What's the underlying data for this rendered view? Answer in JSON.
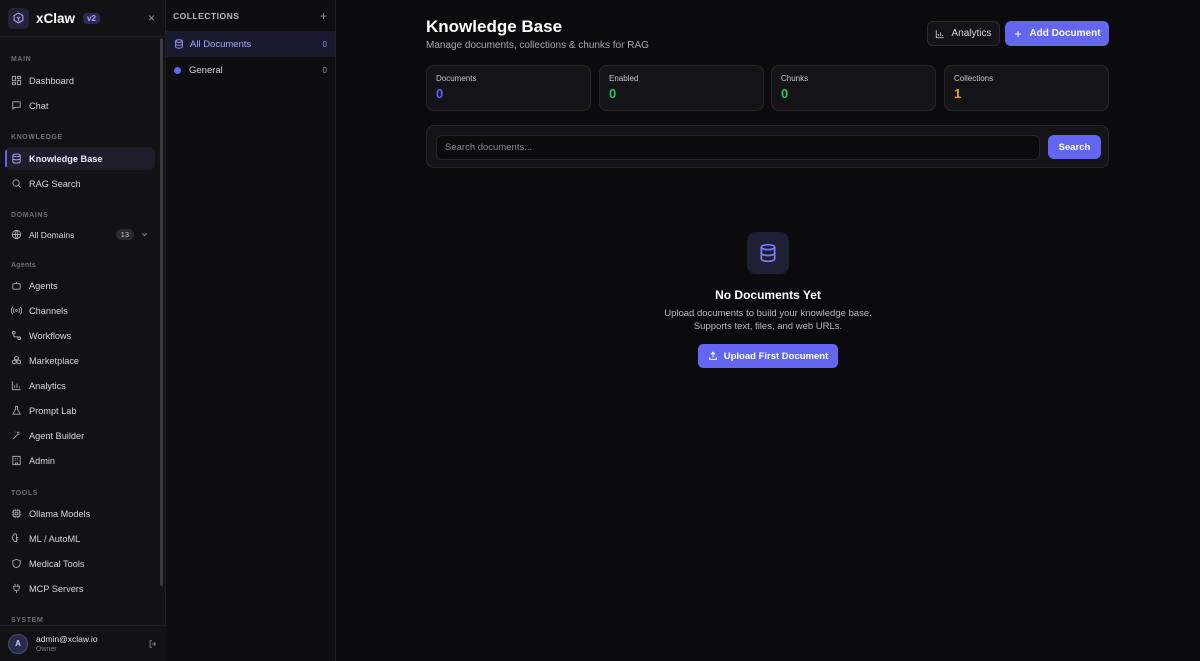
{
  "brand": {
    "name": "xClaw",
    "version": "v2",
    "close_symbol": "×"
  },
  "sidebar": {
    "sections": {
      "main": "MAIN",
      "knowledge": "KNOWLEDGE",
      "domains": "DOMAINS",
      "agents": "Agents",
      "tools": "TOOLS",
      "system": "SYSTEM"
    },
    "items": {
      "dashboard": "Dashboard",
      "chat": "Chat",
      "knowledge_base": "Knowledge Base",
      "rag_search": "RAG Search",
      "all_domains": "All Domains",
      "all_domains_count": "13",
      "agents": "Agents",
      "channels": "Channels",
      "workflows": "Workflows",
      "marketplace": "Marketplace",
      "analytics": "Analytics",
      "prompt_lab": "Prompt Lab",
      "agent_builder": "Agent Builder",
      "admin": "Admin",
      "ollama_models": "Ollama Models",
      "ml_automl": "ML / AutoML",
      "medical_tools": "Medical Tools",
      "mcp_servers": "MCP Servers"
    },
    "active": "Knowledge Base",
    "accent_color": "#6366f1"
  },
  "user": {
    "initial": "A",
    "email": "admin@xclaw.io",
    "role": "Owner"
  },
  "collections": {
    "title": "COLLECTIONS",
    "add_symbol": "+",
    "items": [
      {
        "label": "All Documents",
        "count": "0",
        "active": true
      },
      {
        "label": "General",
        "count": "0",
        "active": false,
        "color": "#6366f1"
      }
    ]
  },
  "main": {
    "title": "Knowledge Base",
    "subtitle": "Manage documents, collections & chunks for RAG",
    "analytics_button": "Analytics",
    "add_button": "Add Document",
    "stats": [
      {
        "label": "Documents",
        "value": "0",
        "color": "#6366f1"
      },
      {
        "label": "Enabled",
        "value": "0",
        "color": "#22c55e"
      },
      {
        "label": "Chunks",
        "value": "0",
        "color": "#22c55e"
      },
      {
        "label": "Collections",
        "value": "1",
        "color": "#f59e0b"
      }
    ],
    "search": {
      "placeholder": "Search documents...",
      "value": "",
      "button": "Search"
    },
    "empty": {
      "title": "No Documents Yet",
      "text": "Upload documents to build your knowledge base. Supports text, files, and web URLs.",
      "button": "Upload First Document"
    }
  }
}
